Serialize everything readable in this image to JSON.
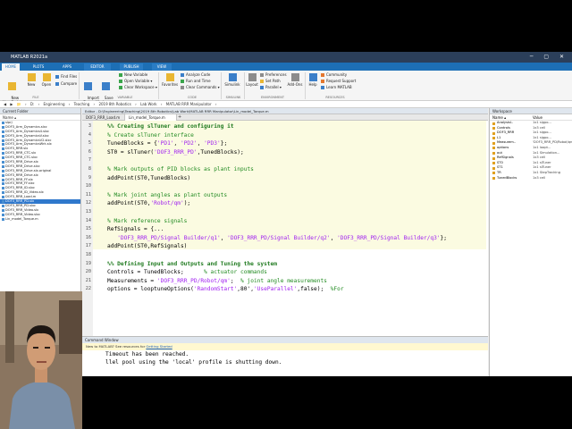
{
  "window": {
    "title": "MATLAB R2021a",
    "controls": "─ ▢ ✕"
  },
  "tabs": [
    {
      "label": "HOME"
    },
    {
      "label": "PLOTS"
    },
    {
      "label": "APPS"
    },
    {
      "label": "EDITOR"
    },
    {
      "label": "PUBLISH"
    },
    {
      "label": "VIEW"
    }
  ],
  "search": {
    "placeholder": "Search Documentation"
  },
  "ribbon": {
    "new_script": "New\nLive Script",
    "new": "New",
    "open": "Open",
    "find_files": "Find Files",
    "compare": "Compare",
    "import": "Import\nData",
    "save_ws": "Save\nWorkspace",
    "new_variable": "New Variable",
    "open_variable": "Open Variable ▾",
    "clear_workspace": "Clear Workspace ▾",
    "favorites": "Favorites",
    "analyze_code": "Analyze Code",
    "run_and_time": "Run and Time",
    "clear_commands": "Clear Commands ▾",
    "simulink": "Simulink",
    "layout": "Layout",
    "preferences": "Preferences",
    "set_path": "Set Path",
    "parallel": "Parallel ▾",
    "addons": "Add-Ons",
    "help": "Help",
    "community": "Community",
    "request_support": "Request Support",
    "learn_matlab": "Learn MATLAB",
    "groups": {
      "file": "FILE",
      "variable": "VARIABLE",
      "code": "CODE",
      "simulink": "SIMULINK",
      "environment": "ENVIRONMENT",
      "resources": "RESOURCES"
    }
  },
  "path": [
    "◀",
    "▶",
    "📁",
    "›",
    "D:",
    "›",
    "Engineering",
    "›",
    "Teaching",
    "›",
    "2019 8th Robotics",
    "›",
    "Lab Work",
    "›",
    "MATLAB RRR Manipulator",
    "›"
  ],
  "current_folder": {
    "title": "Current Folder",
    "column": "Name ▴",
    "files": [
      "slprj",
      "DOF3_Arm_Dynamics.slxc",
      "DOF3_Arm_Dynamics4.slxc",
      "DOF3_Arm_DynamicsV.slxc",
      "DOF3_Arm_DynamicsV2.slxc",
      "DOF3_Arm_DynamicsWrk.slx",
      "DOF3_RRR.slx",
      "DOF3_RRR_CTC.slx",
      "DOF3_RRR_CTC.slxc",
      "DOF3_RRR_Drive.slx",
      "DOF3_RRR_Drive.slxc",
      "DOF3_RRR_Drive.slx.original",
      "DOF3_RRR_Drive.slx",
      "DOF3_RRR_FF.slx",
      "DOF3_RRR_FF.slxc",
      "DOF3_RRR_ID.slxc",
      "DOF3_RRR_ID_Video.slx",
      "DOF3_RRR_Load.m",
      "DOF3_RRR_PD.slx",
      "DOF3_RRR_PD.slxc",
      "DOF3_RRR_Video.slx",
      "DOF3_RRR_Video.slxc",
      "Lin_model_Torque.m"
    ],
    "selected_index": 18,
    "details": "Details"
  },
  "editor": {
    "title": "Editor - D:\\Engineering\\Teaching\\2019 8th Robotics\\Lab Work\\MATLAB RRR Manipulator\\Lin_model_Torque.m",
    "tabs": [
      "DOF3_RRR_Load.m",
      "Lin_model_Torque.m"
    ],
    "add_tab": "+",
    "lines": [
      {
        "n": "3",
        "segs": [
          {
            "t": "%% Creating slTuner and configuring it",
            "c": "cell-title"
          }
        ]
      },
      {
        "n": "4",
        "segs": [
          {
            "t": "% Create slTuner interface",
            "c": "comment"
          }
        ]
      },
      {
        "n": "5",
        "segs": [
          {
            "t": "TunedBlocks = {",
            "c": ""
          },
          {
            "t": "'PD1'",
            "c": "str"
          },
          {
            "t": ", ",
            "c": ""
          },
          {
            "t": "'PD2'",
            "c": "str"
          },
          {
            "t": ", ",
            "c": ""
          },
          {
            "t": "'PD3'",
            "c": "str"
          },
          {
            "t": "};",
            "c": ""
          }
        ]
      },
      {
        "n": "6",
        "segs": [
          {
            "t": "ST0 = slTuner(",
            "c": ""
          },
          {
            "t": "'DOF3_RRR_PD'",
            "c": "str"
          },
          {
            "t": ",TunedBlocks);",
            "c": ""
          }
        ]
      },
      {
        "n": "7",
        "segs": []
      },
      {
        "n": "8",
        "segs": [
          {
            "t": "% Mark outputs of PID blocks as plant inputs",
            "c": "comment"
          }
        ]
      },
      {
        "n": "9",
        "segs": [
          {
            "t": "addPoint(ST0,TunedBlocks)",
            "c": ""
          }
        ]
      },
      {
        "n": "10",
        "segs": []
      },
      {
        "n": "11",
        "segs": [
          {
            "t": "% Mark joint angles as plant outputs",
            "c": "comment"
          }
        ]
      },
      {
        "n": "12",
        "segs": [
          {
            "t": "addPoint(ST0,",
            "c": ""
          },
          {
            "t": "'Robot/qm'",
            "c": "str"
          },
          {
            "t": ");",
            "c": ""
          }
        ]
      },
      {
        "n": "13",
        "segs": []
      },
      {
        "n": "14",
        "segs": [
          {
            "t": "% Mark reference signals",
            "c": "comment"
          }
        ]
      },
      {
        "n": "15",
        "segs": [
          {
            "t": "RefSignals = {...",
            "c": ""
          }
        ]
      },
      {
        "n": "16",
        "segs": [
          {
            "t": "   ",
            "c": ""
          },
          {
            "t": "'DOF3_RRR_PD/Signal Builder/q1'",
            "c": "str"
          },
          {
            "t": ", ",
            "c": ""
          },
          {
            "t": "'DOF3_RRR_PD/Signal Builder/q2'",
            "c": "str"
          },
          {
            "t": ", ",
            "c": ""
          },
          {
            "t": "'DOF3_RRR_PD/Signal Builder/q3'",
            "c": "str"
          },
          {
            "t": "};",
            "c": ""
          }
        ]
      },
      {
        "n": "17",
        "segs": [
          {
            "t": "addPoint(ST0,RefSignals)",
            "c": ""
          }
        ]
      },
      {
        "n": "18",
        "segs": []
      },
      {
        "n": "19",
        "segs": [
          {
            "t": "%% Defining Input and Outputs and Tuning the system",
            "c": "cell-title"
          }
        ]
      },
      {
        "n": "20",
        "segs": [
          {
            "t": "Controls = TunedBlocks;      ",
            "c": ""
          },
          {
            "t": "% actuator commands",
            "c": "comment"
          }
        ]
      },
      {
        "n": "21",
        "segs": [
          {
            "t": "Measurements = ",
            "c": ""
          },
          {
            "t": "'DOF3_RRR_PD/Robot/qm'",
            "c": "str"
          },
          {
            "t": ";  ",
            "c": ""
          },
          {
            "t": "% joint angle measurements",
            "c": "comment"
          }
        ]
      },
      {
        "n": "22",
        "segs": [
          {
            "t": "options = looptuneOptions(",
            "c": ""
          },
          {
            "t": "'RandomStart'",
            "c": "str"
          },
          {
            "t": ",80',",
            "c": ""
          },
          {
            "t": "'UseParallel'",
            "c": "str"
          },
          {
            "t": ",false);  ",
            "c": ""
          },
          {
            "t": "%For",
            "c": "comment"
          }
        ]
      }
    ]
  },
  "command_window": {
    "title": "Command Window",
    "banner_text": "New to MATLAB? See resources for ",
    "banner_link": "Getting Started",
    "lines": [
      "Timeout has been reached.",
      "llel pool using the 'local' profile is shutting down."
    ]
  },
  "workspace": {
    "title": "Workspace",
    "col_name": "Name ▴",
    "col_value": "Value",
    "vars": [
      {
        "name": "AnalysisI..",
        "value": "1x1 sigpo..."
      },
      {
        "name": "Controls",
        "value": "1x3 cell"
      },
      {
        "name": "DOF3_RRR",
        "value": "1x1 sigpo..."
      },
      {
        "name": "L1",
        "value": "1x1 sigpo..."
      },
      {
        "name": "Measurem..",
        "value": "'DOF3_RRR_PD/Robot/qm'"
      },
      {
        "name": "options",
        "value": "1x1 loopt..."
      },
      {
        "name": "out",
        "value": "1x1 Simulation..."
      },
      {
        "name": "RefSignals",
        "value": "1x3 cell"
      },
      {
        "name": "ST0",
        "value": "1x1 slTuner"
      },
      {
        "name": "ST1",
        "value": "1x1 slTuner"
      },
      {
        "name": "TR",
        "value": "1x1 StepTracking"
      },
      {
        "name": "TunedBlocks",
        "value": "1x3 cell"
      }
    ]
  },
  "colors": {
    "accent": "#1d6fb5",
    "titlebar": "#2b3f5a",
    "cell_bg": "#fbfbe1",
    "comment": "#228b22",
    "string": "#a020f0"
  }
}
